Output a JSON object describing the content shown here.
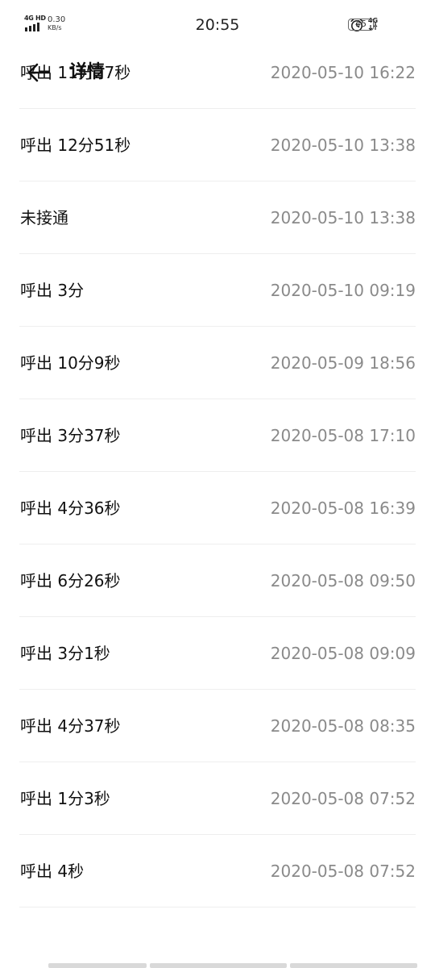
{
  "status_bar": {
    "network_type": "4G HD",
    "net_speed_value": "0.30",
    "net_speed_unit": "KB/s",
    "time": "20:55",
    "secondary_network": "4G",
    "battery_level": "45"
  },
  "app_bar": {
    "title": "详情"
  },
  "calls": [
    {
      "type": "呼出 11分27秒",
      "time": "2020-05-10 16:22"
    },
    {
      "type": "呼出 12分51秒",
      "time": "2020-05-10 13:38"
    },
    {
      "type": "未接通",
      "time": "2020-05-10 13:38"
    },
    {
      "type": "呼出 3分",
      "time": "2020-05-10 09:19"
    },
    {
      "type": "呼出 10分9秒",
      "time": "2020-05-09 18:56"
    },
    {
      "type": "呼出 3分37秒",
      "time": "2020-05-08 17:10"
    },
    {
      "type": "呼出 4分36秒",
      "time": "2020-05-08 16:39"
    },
    {
      "type": "呼出 6分26秒",
      "time": "2020-05-08 09:50"
    },
    {
      "type": "呼出 3分1秒",
      "time": "2020-05-08 09:09"
    },
    {
      "type": "呼出 4分37秒",
      "time": "2020-05-08 08:35"
    },
    {
      "type": "呼出 1分3秒",
      "time": "2020-05-08 07:52"
    },
    {
      "type": "呼出 4秒",
      "time": "2020-05-08 07:52"
    }
  ]
}
